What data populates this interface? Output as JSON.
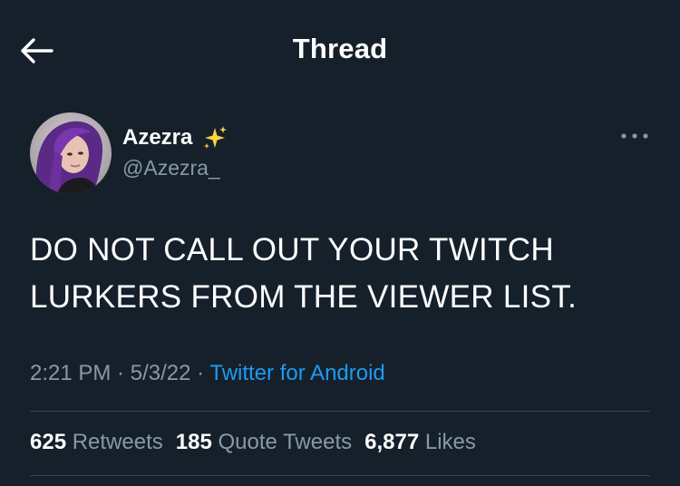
{
  "header": {
    "title": "Thread",
    "back_icon": "arrow-left-icon"
  },
  "author": {
    "display_name": "Azezra",
    "badge_icon": "sparkles-icon",
    "handle": "@Azezra_"
  },
  "tweet": {
    "text_line1": "DO NOT CALL OUT YOUR TWITCH",
    "text_line2": "LURKERS FROM THE VIEWER LIST."
  },
  "meta": {
    "time": "2:21 PM",
    "separator": " · ",
    "date": "5/3/22",
    "source": "Twitter for Android"
  },
  "stats": {
    "retweets_count": "625",
    "retweets_label": "Retweets",
    "quotes_count": "185",
    "quotes_label": "Quote Tweets",
    "likes_count": "6,877",
    "likes_label": "Likes"
  },
  "colors": {
    "background": "#15202b",
    "text": "#ffffff",
    "secondary": "#8899a6",
    "link": "#1d9bf0",
    "divider": "#38444d",
    "sparkle": "#ffd23f"
  }
}
